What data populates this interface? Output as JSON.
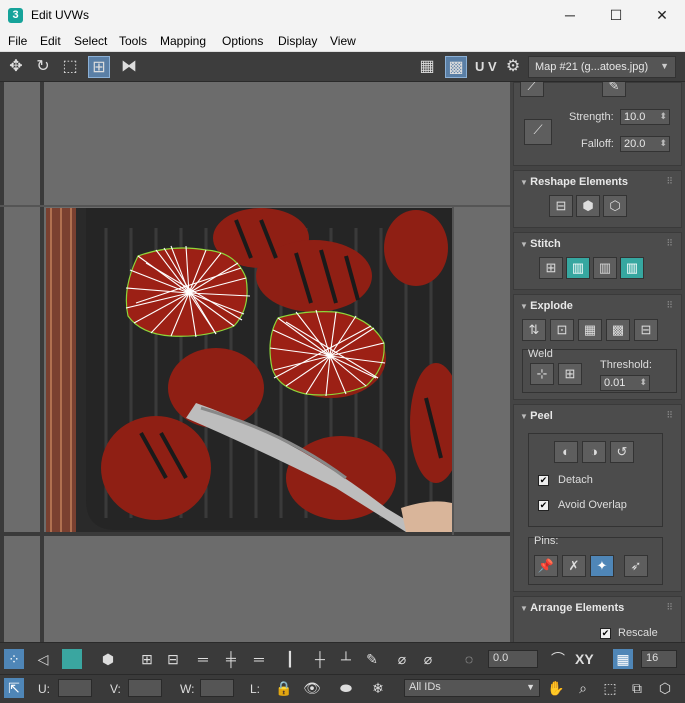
{
  "window": {
    "app_icon": "3",
    "title": "Edit UVWs",
    "minimize": "─",
    "maximize": "☐",
    "close": "✕"
  },
  "menu": [
    "File",
    "Edit",
    "Select",
    "Tools",
    "Mapping",
    "Options",
    "Display",
    "View"
  ],
  "toolbar": {
    "uv_label": "U V",
    "map_dropdown": "Map #21 (g...atoes.jpg)"
  },
  "soft_select": {
    "strength_label": "Strength:",
    "strength_value": "10.0",
    "falloff_label": "Falloff:",
    "falloff_value": "20.0"
  },
  "reshape": {
    "title": "Reshape Elements"
  },
  "stitch": {
    "title": "Stitch"
  },
  "explode": {
    "title": "Explode",
    "weld_label": "Weld",
    "threshold_label": "Threshold:",
    "threshold_value": "0.01"
  },
  "peel": {
    "title": "Peel",
    "detach_label": "Detach",
    "detach_checked": true,
    "avoid_overlap_label": "Avoid Overlap",
    "avoid_overlap_checked": true,
    "pins_label": "Pins:"
  },
  "arrange": {
    "title": "Arrange Elements",
    "rescale_label": "Rescale",
    "rescale_checked": true
  },
  "status_bottom": {
    "angle_value": "0.0",
    "xy_label": "XY",
    "grid_value": "16",
    "u_label": "U:",
    "v_label": "V:",
    "w_label": "W:",
    "l_label": "L:",
    "ids_dropdown": "All IDs"
  },
  "colors": {
    "accent_teal": "#36a7a0",
    "active_blue": "#4f86b7",
    "uv_outline": "#8ed63a",
    "uv_lines": "#ffffff"
  },
  "icons": [
    "move-icon",
    "rotate-icon",
    "freeform-icon",
    "mirror-icon",
    "checker-icon",
    "hand-icon",
    "zoom-icon",
    "snowflake-icon",
    "lock-icon",
    "eye-icon"
  ]
}
